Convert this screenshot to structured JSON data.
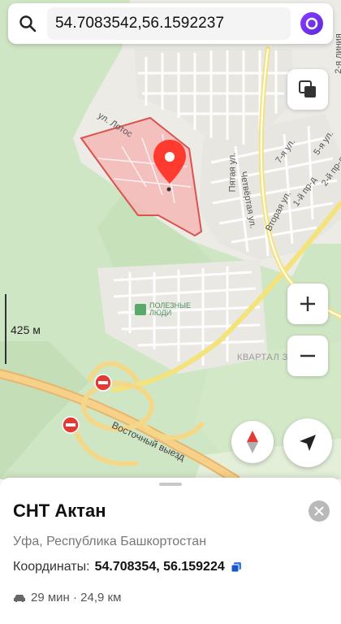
{
  "search": {
    "query": "54.7083542,56.1592237"
  },
  "map": {
    "scale_label": "425 м",
    "streets": [
      {
        "id": "lotos",
        "label": "ул. Лотос"
      },
      {
        "id": "pyataya",
        "label": "Пятая ул."
      },
      {
        "id": "chetvertaya",
        "label": "Четвёртая ул."
      },
      {
        "id": "vtoraya",
        "label": "Вторая ул."
      },
      {
        "id": "sedmaya",
        "label": "7-я ул."
      },
      {
        "id": "pyataya2",
        "label": "5-я ул."
      },
      {
        "id": "pervy_pr",
        "label": "1-й пр-д"
      },
      {
        "id": "vtoroy_pr",
        "label": "2-й пр-д"
      },
      {
        "id": "vtoraya_liniya",
        "label": "2-я линия"
      },
      {
        "id": "vostochny",
        "label": "Восточный выезд"
      },
      {
        "id": "kvartal",
        "label": "КВАРТАЛ З"
      }
    ],
    "poi_label": "ПОЛЕЗНЫЕ ЛЮДИ",
    "colors": {
      "parcel_fill": "#f5b8b6",
      "parcel_stroke": "#d9534f",
      "pin": "#ff3b30",
      "forest": "#cfe6c4"
    }
  },
  "card": {
    "title": "СНТ Актан",
    "subtitle": "Уфа, Республика Башкортостан",
    "coords_label": "Координаты:",
    "coords_value": "54.708354, 56.159224",
    "route": "29 мин · 24,9 км"
  },
  "icons": {
    "search": "search-icon",
    "alice": "alice-icon",
    "layers": "layers-icon",
    "zoom_in": "plus-icon",
    "zoom_out": "minus-icon",
    "compass": "compass-icon",
    "locate": "location-arrow-icon",
    "close": "close-icon",
    "copy": "copy-icon",
    "car": "car-icon"
  }
}
